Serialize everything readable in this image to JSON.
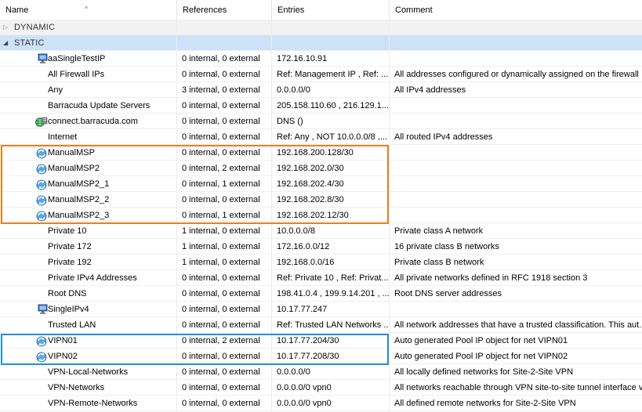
{
  "columns": {
    "name": "Name",
    "references": "References",
    "entries": "Entries",
    "comment": "Comment"
  },
  "groups": {
    "dynamic": "DYNAMIC",
    "static": "STATIC"
  },
  "rows": [
    {
      "name": "aaSingleTestIP",
      "icon": "network-host-icon",
      "references": "0 internal,  0 external",
      "entries": "172.16.10.91",
      "comment": ""
    },
    {
      "name": "All Firewall IPs",
      "icon": "",
      "references": "0 internal,  0 external",
      "entries": "Ref: Management IP , Ref: ...",
      "comment": "All addresses configured or dynamically assigned on the firewall"
    },
    {
      "name": "Any",
      "icon": "",
      "references": "3 internal,  0 external",
      "entries": "0.0.0.0/0",
      "comment": "All IPv4 addresses"
    },
    {
      "name": "Barracuda Update Servers",
      "icon": "",
      "references": "0 internal,  0 external",
      "entries": "205.158.110.60 , 216.129.1...",
      "comment": ""
    },
    {
      "name": "connect.barracuda.com",
      "icon": "globe-host-icon",
      "references": "0 internal,  0 external",
      "entries": "DNS ()",
      "comment": ""
    },
    {
      "name": "Internet",
      "icon": "",
      "references": "0 internal,  0 external",
      "entries": "Ref: Any , NOT 10.0.0.0/8 ,...",
      "comment": "All routed IPv4 addresses"
    },
    {
      "name": "ManualMSP",
      "icon": "refresh-network-icon",
      "references": "0 internal,  0 external",
      "entries": "192.168.200.128/30",
      "comment": ""
    },
    {
      "name": "ManualMSP2",
      "icon": "refresh-network-icon",
      "references": "0 internal,  2 external",
      "entries": "192.168.202.0/30",
      "comment": ""
    },
    {
      "name": "ManualMSP2_1",
      "icon": "refresh-network-icon",
      "references": "0 internal,  1 external",
      "entries": "192.168.202.4/30",
      "comment": ""
    },
    {
      "name": "ManualMSP2_2",
      "icon": "refresh-network-icon",
      "references": "0 internal,  0 external",
      "entries": "192.168.202.8/30",
      "comment": ""
    },
    {
      "name": "ManualMSP2_3",
      "icon": "refresh-network-icon",
      "references": "0 internal,  1 external",
      "entries": "192.168.202.12/30",
      "comment": ""
    },
    {
      "name": "Private 10",
      "icon": "",
      "references": "1 internal,  0 external",
      "entries": "10.0.0.0/8",
      "comment": "Private class A network"
    },
    {
      "name": "Private 172",
      "icon": "",
      "references": "1 internal,  0 external",
      "entries": "172.16.0.0/12",
      "comment": "16 private class B networks"
    },
    {
      "name": "Private 192",
      "icon": "",
      "references": "1 internal,  0 external",
      "entries": "192.168.0.0/16",
      "comment": "Private class B network"
    },
    {
      "name": "Private IPv4 Addresses",
      "icon": "",
      "references": "0 internal,  0 external",
      "entries": "Ref: Private 10 , Ref: Privat...",
      "comment": "All private networks defined in RFC 1918 section 3"
    },
    {
      "name": "Root DNS",
      "icon": "",
      "references": "0 internal,  0 external",
      "entries": "198.41.0.4 , 199.9.14.201 , ...",
      "comment": "Root DNS server addresses"
    },
    {
      "name": "SingleIPv4",
      "icon": "network-host-icon",
      "references": "0 internal,  0 external",
      "entries": "10.17.77.247",
      "comment": ""
    },
    {
      "name": "Trusted LAN",
      "icon": "",
      "references": "0 internal,  0 external",
      "entries": "Ref: Trusted LAN Networks ...",
      "comment": "All network addresses that have a trusted classification. This aut..."
    },
    {
      "name": "VIPN01",
      "icon": "refresh-network-icon",
      "references": "0 internal,  2 external",
      "entries": "10.17.77.204/30",
      "comment": "Auto generated Pool IP object for net VIPN01"
    },
    {
      "name": "VIPN02",
      "icon": "refresh-network-icon",
      "references": "0 internal,  0 external",
      "entries": "10.17.77.208/30",
      "comment": "Auto generated Pool IP object for net VIPN02"
    },
    {
      "name": "VPN-Local-Networks",
      "icon": "",
      "references": "0 internal,  0 external",
      "entries": "0.0.0.0/0",
      "comment": "All locally defined networks for Site-2-Site VPN"
    },
    {
      "name": "VPN-Networks",
      "icon": "",
      "references": "0 internal,  0 external",
      "entries": "0.0.0.0/0 vpn0",
      "comment": "All networks reachable through VPN site-to-site tunnel interface v..."
    },
    {
      "name": "VPN-Remote-Networks",
      "icon": "",
      "references": "0 internal,  0 external",
      "entries": "0.0.0.0/0 vpn0",
      "comment": "All defined remote networks for Site-2-Site VPN"
    }
  ],
  "highlight_colors": {
    "orange": "#f07d19",
    "blue": "#1f8ee6"
  }
}
